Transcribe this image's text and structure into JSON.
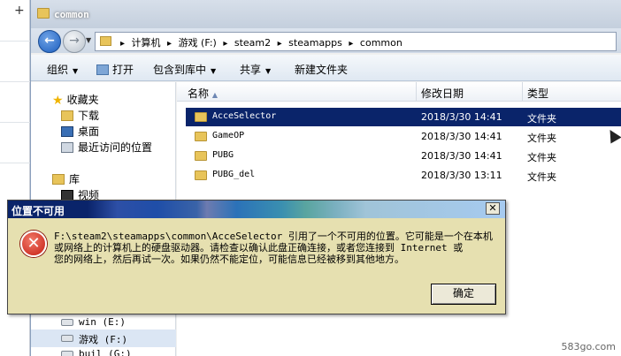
{
  "window": {
    "title": "common"
  },
  "address": {
    "segments": [
      "计算机",
      "游戏 (F:)",
      "steam2",
      "steamapps",
      "common"
    ]
  },
  "toolbar": {
    "organize": "组织",
    "open": "打开",
    "include_library": "包含到库中",
    "share": "共享",
    "new_folder": "新建文件夹"
  },
  "navpane": {
    "favorites": "收藏夹",
    "downloads": "下载",
    "desktop": "桌面",
    "recent": "最近访问的位置",
    "library": "库",
    "video": "视频",
    "drives": [
      {
        "label": "win (E:)"
      },
      {
        "label": "游戏 (F:)"
      },
      {
        "label": "buil (G:)"
      }
    ]
  },
  "columns": {
    "name": "名称",
    "date": "修改日期",
    "type": "类型"
  },
  "files": [
    {
      "name": "AcceSelector",
      "date": "2018/3/30 14:41",
      "type": "文件夹"
    },
    {
      "name": "GameOP",
      "date": "2018/3/30 14:41",
      "type": "文件夹"
    },
    {
      "name": "PUBG",
      "date": "2018/3/30 14:41",
      "type": "文件夹"
    },
    {
      "name": "PUBG_del",
      "date": "2018/3/30 13:11",
      "type": "文件夹"
    }
  ],
  "dialog": {
    "title": "位置不可用",
    "message_line1": "F:\\steam2\\steamapps\\common\\AcceSelector 引用了一个不可用的位置。它可能是一个在本机",
    "message_line2": "或网络上的计算机上的硬盘驱动器。请检查以确认此盘正确连接，或者您连接到 Internet 或",
    "message_line3": "您的网络上，然后再试一次。如果仍然不能定位，可能信息已经被移到其他地方。",
    "ok": "确定"
  },
  "watermark": "583go.com"
}
